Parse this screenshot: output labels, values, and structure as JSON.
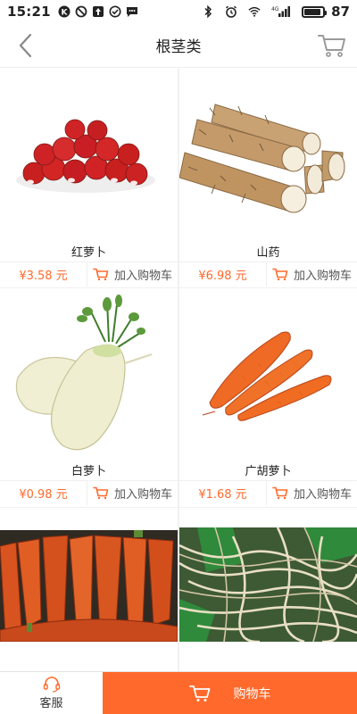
{
  "status_bar": {
    "time": "15:21",
    "network": "4G",
    "battery_percent": "87",
    "battery_level": 0.87
  },
  "header": {
    "title": "根茎类"
  },
  "products": [
    {
      "name": "红萝卜",
      "price": "¥3.58 元",
      "add_to_cart": "加入购物车",
      "image": "radish-image"
    },
    {
      "name": "山药",
      "price": "¥6.98 元",
      "add_to_cart": "加入购物车",
      "image": "yam-image"
    },
    {
      "name": "白萝卜",
      "price": "¥0.98 元",
      "add_to_cart": "加入购物车",
      "image": "white-radish-image"
    },
    {
      "name": "广胡萝卜",
      "price": "¥1.68 元",
      "add_to_cart": "加入购物车",
      "image": "carrot-image"
    },
    {
      "name": "",
      "price": "",
      "add_to_cart": "",
      "image": "carrot-pile-image"
    },
    {
      "name": "",
      "price": "",
      "add_to_cart": "",
      "image": "roots-image"
    }
  ],
  "bottom_bar": {
    "service_label": "客服",
    "cart_label": "购物车"
  },
  "colors": {
    "accent": "#ff6a2c",
    "price": "#ff6a2c"
  }
}
